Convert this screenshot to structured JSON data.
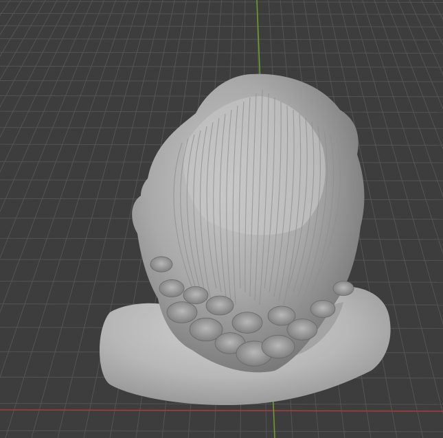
{
  "viewport": {
    "name": "3D Viewport",
    "background_color": "#3d3d3d",
    "grid_line_color": "#545454",
    "x_axis_color": "#a33a44",
    "y_axis_color": "#6f9b2a",
    "object": {
      "name": "sculpted-bust",
      "base_color": "#bdbdbd",
      "shade_color": "#8c8c8c",
      "highlight_color": "#d6d6d6"
    }
  }
}
